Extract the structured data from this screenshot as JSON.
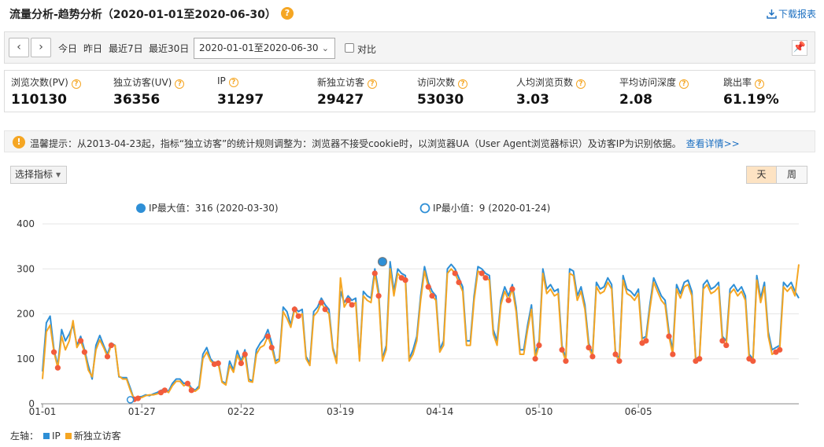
{
  "header": {
    "title": "流量分析-趋势分析（2020-01-01至2020-06-30）",
    "help": "?",
    "download": "下载报表"
  },
  "toolbar": {
    "prev": "‹",
    "next": "›",
    "quick_ranges": [
      "今日",
      "昨日",
      "最近7日",
      "最近30日"
    ],
    "date_range": "2020-01-01至2020-06-30",
    "compare_label": "对比",
    "compare_checked": false
  },
  "metrics": [
    {
      "label": "浏览次数(PV)",
      "value": "110130"
    },
    {
      "label": "独立访客(UV)",
      "value": "36356"
    },
    {
      "label": "IP",
      "value": "31297"
    },
    {
      "label": "新独立访客",
      "value": "29427"
    },
    {
      "label": "访问次数",
      "value": "53030"
    },
    {
      "label": "人均浏览页数",
      "value": "3.03"
    },
    {
      "label": "平均访问深度",
      "value": "2.08"
    },
    {
      "label": "跳出率",
      "value": "61.19%"
    }
  ],
  "notice": {
    "icon": "!",
    "text": "温馨提示：从2013-04-23起，指标“独立访客”的统计规则调整为：浏览器不接受cookie时，以浏览器UA（User Agent浏览器标识）及访客IP为识别依据。",
    "link": "查看详情>>"
  },
  "controls": {
    "metric_select": "选择指标",
    "granularity": [
      "天",
      "周"
    ],
    "active_granularity": "天"
  },
  "legend_footer": {
    "axis": "左轴：",
    "items": [
      "IP",
      "新独立访客"
    ]
  },
  "colors": {
    "ip": "#2e8fd6",
    "new_visitor": "#f5a623",
    "weekend_marker": "#f25c3c",
    "accent": "#f5a623",
    "link": "#1b6fc1"
  },
  "chart_data": {
    "type": "line",
    "start_date": "2020-01-01",
    "x_tick_labels": [
      "01-01",
      "01-27",
      "02-22",
      "03-19",
      "04-14",
      "05-10",
      "06-05"
    ],
    "ylim": [
      0,
      400
    ],
    "y_ticks": [
      0,
      100,
      200,
      300,
      400
    ],
    "annotations": {
      "max": {
        "label": "IP最大值：316 (2020-03-30)",
        "value": 316,
        "date": "2020-03-30"
      },
      "min": {
        "label": "IP最小值：9 (2020-01-24)",
        "value": 9,
        "date": "2020-01-24"
      }
    },
    "series": [
      {
        "name": "IP",
        "color": "#2e8fd6",
        "values": [
          72,
          180,
          195,
          120,
          85,
          165,
          140,
          155,
          175,
          130,
          150,
          120,
          85,
          55,
          130,
          152,
          130,
          110,
          135,
          130,
          60,
          58,
          58,
          35,
          9,
          15,
          16,
          20,
          18,
          22,
          25,
          30,
          32,
          28,
          45,
          55,
          55,
          45,
          48,
          35,
          30,
          40,
          110,
          125,
          100,
          90,
          95,
          50,
          45,
          95,
          75,
          118,
          95,
          120,
          55,
          50,
          120,
          135,
          145,
          165,
          135,
          95,
          100,
          215,
          205,
          175,
          215,
          205,
          210,
          105,
          90,
          205,
          215,
          235,
          220,
          210,
          125,
          95,
          250,
          225,
          240,
          230,
          235,
          100,
          250,
          240,
          235,
          300,
          250,
          100,
          130,
          316,
          250,
          300,
          290,
          285,
          100,
          120,
          150,
          240,
          305,
          270,
          250,
          240,
          120,
          140,
          300,
          310,
          300,
          280,
          260,
          140,
          140,
          240,
          305,
          300,
          290,
          285,
          165,
          140,
          230,
          260,
          240,
          265,
          215,
          120,
          120,
          175,
          220,
          110,
          140,
          300,
          255,
          265,
          250,
          255,
          130,
          100,
          300,
          295,
          240,
          260,
          220,
          135,
          110,
          270,
          255,
          260,
          280,
          265,
          115,
          100,
          285,
          255,
          250,
          240,
          255,
          145,
          150,
          220,
          280,
          260,
          240,
          230,
          160,
          120,
          265,
          245,
          270,
          275,
          250,
          100,
          105,
          265,
          275,
          255,
          260,
          270,
          150,
          140,
          255,
          265,
          250,
          260,
          240,
          110,
          100,
          285,
          235,
          270,
          160,
          120,
          125,
          130,
          270,
          260,
          270,
          250,
          235
        ]
      },
      {
        "name": "新独立访客",
        "color": "#f5a623",
        "values": [
          55,
          160,
          175,
          115,
          80,
          150,
          120,
          140,
          185,
          125,
          140,
          115,
          75,
          60,
          120,
          142,
          125,
          105,
          130,
          130,
          62,
          55,
          55,
          30,
          10,
          12,
          14,
          18,
          20,
          20,
          22,
          25,
          30,
          25,
          40,
          50,
          50,
          40,
          45,
          30,
          28,
          35,
          100,
          115,
          95,
          88,
          90,
          48,
          42,
          85,
          70,
          108,
          90,
          110,
          50,
          48,
          110,
          125,
          130,
          150,
          125,
          90,
          95,
          205,
          190,
          170,
          210,
          195,
          200,
          100,
          85,
          195,
          205,
          225,
          210,
          200,
          120,
          90,
          280,
          215,
          230,
          220,
          225,
          95,
          240,
          230,
          225,
          290,
          240,
          95,
          120,
          300,
          240,
          290,
          280,
          275,
          95,
          110,
          140,
          230,
          295,
          260,
          240,
          230,
          115,
          130,
          290,
          300,
          290,
          270,
          250,
          130,
          130,
          230,
          295,
          290,
          280,
          275,
          155,
          130,
          220,
          250,
          230,
          255,
          205,
          110,
          110,
          165,
          210,
          100,
          130,
          290,
          245,
          255,
          240,
          245,
          120,
          95,
          290,
          285,
          230,
          250,
          210,
          125,
          105,
          260,
          245,
          250,
          270,
          255,
          110,
          95,
          275,
          245,
          240,
          230,
          245,
          135,
          140,
          210,
          270,
          250,
          230,
          220,
          150,
          110,
          255,
          235,
          260,
          265,
          240,
          95,
          100,
          255,
          265,
          245,
          250,
          260,
          140,
          130,
          245,
          255,
          240,
          250,
          230,
          100,
          95,
          275,
          225,
          260,
          150,
          110,
          115,
          120,
          260,
          250,
          260,
          240,
          310
        ]
      }
    ],
    "weekend_marker_series": "新独立访客"
  }
}
